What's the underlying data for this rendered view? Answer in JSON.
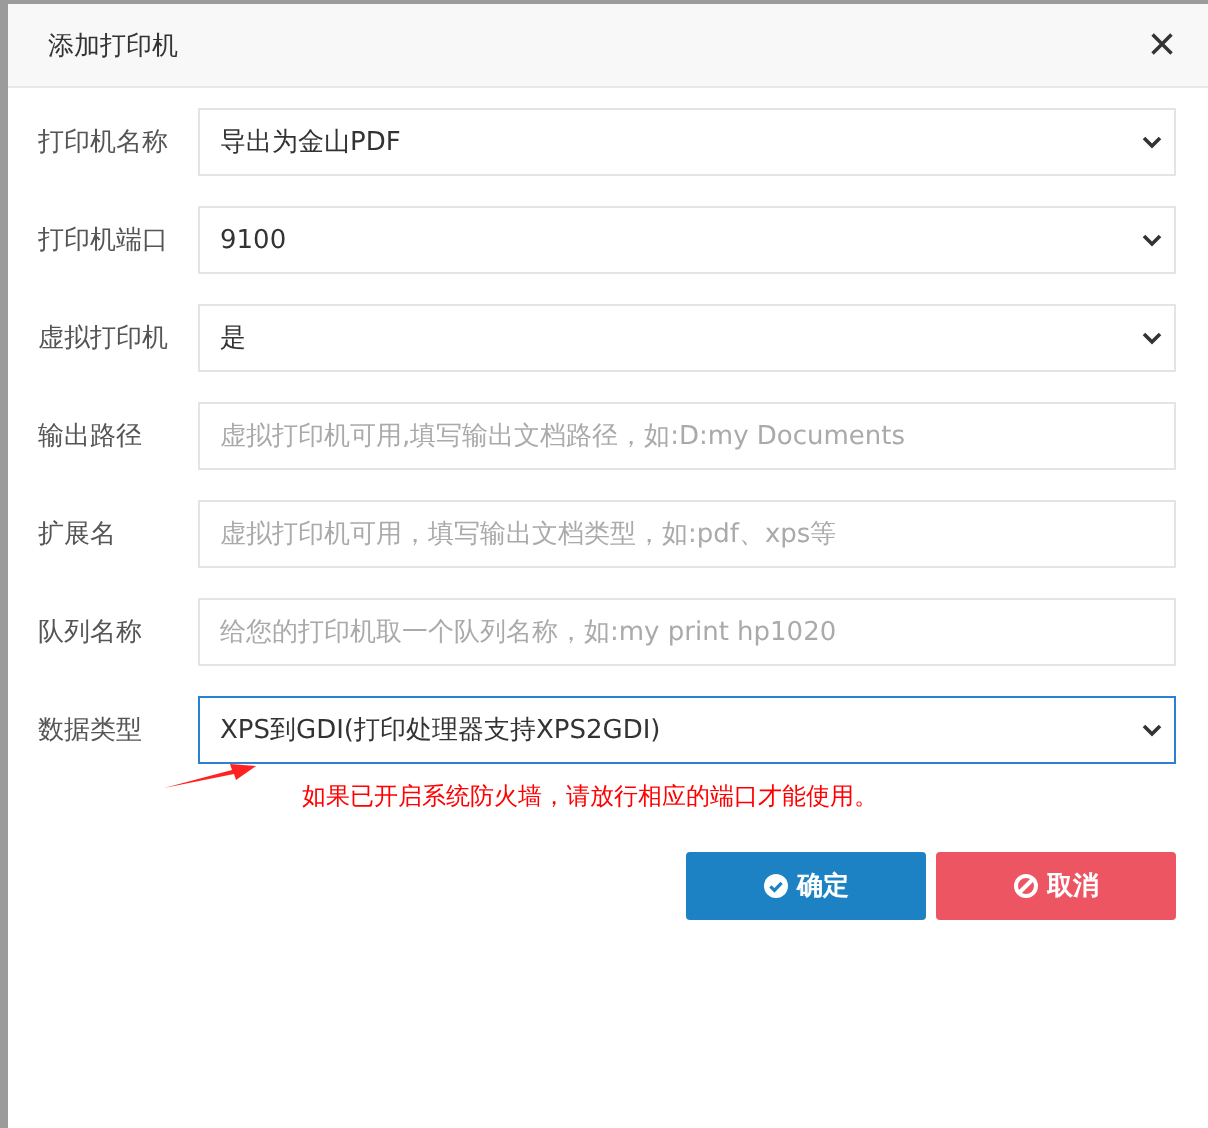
{
  "dialog": {
    "title": "添加打印机",
    "close": "×"
  },
  "fields": [
    {
      "label": "打印机名称",
      "kind": "select",
      "value": "导出为金山PDF",
      "focused": false
    },
    {
      "label": "打印机端口",
      "kind": "select",
      "value": "9100",
      "focused": false
    },
    {
      "label": "虚拟打印机",
      "kind": "select",
      "value": "是",
      "focused": false
    },
    {
      "label": "输出路径",
      "kind": "input",
      "placeholder": "虚拟打印机可用,填写输出文档路径，如:D:my Documents",
      "focused": false
    },
    {
      "label": "扩展名",
      "kind": "input",
      "placeholder": "虚拟打印机可用，填写输出文档类型，如:pdf、xps等",
      "focused": false
    },
    {
      "label": "队列名称",
      "kind": "input",
      "placeholder": "给您的打印机取一个队列名称，如:my print hp1020",
      "focused": false
    },
    {
      "label": "数据类型",
      "kind": "select",
      "value": "XPS到GDI(打印处理器支持XPS2GDI)",
      "focused": true
    }
  ],
  "warning": "如果已开启系统防火墙，请放行相应的端口才能使用。",
  "buttons": [
    {
      "label": "确定",
      "kind": "confirm"
    },
    {
      "label": "取消",
      "kind": "cancel"
    }
  ]
}
